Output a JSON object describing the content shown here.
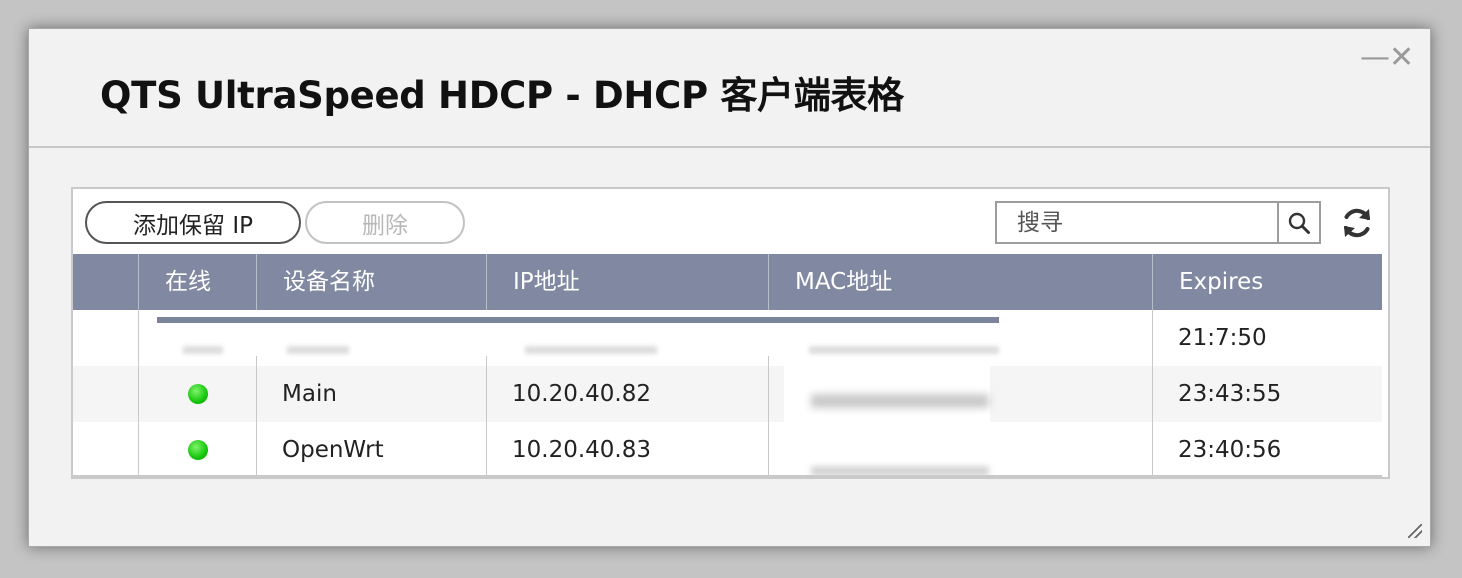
{
  "window": {
    "title": "QTS UltraSpeed HDCP - DHCP 客户端表格",
    "minimize_glyph": "—",
    "close_glyph": "✕"
  },
  "toolbar": {
    "add_reserved_ip_label": "添加保留 IP",
    "delete_label": "删除",
    "search_placeholder": "搜寻",
    "search_icon": "search-icon",
    "refresh_icon": "refresh-icon"
  },
  "table": {
    "columns": [
      "",
      "在线",
      "设备名称",
      "IP地址",
      "MAC地址",
      "Expires"
    ],
    "rows": [
      {
        "online": null,
        "device_name": "",
        "ip": "",
        "mac": "",
        "expires": "21:7:50",
        "redacted": true
      },
      {
        "online": true,
        "device_name": "Main",
        "ip": "10.20.40.82",
        "mac": "",
        "expires": "23:43:55",
        "redacted": false
      },
      {
        "online": true,
        "device_name": "OpenWrt",
        "ip": "10.20.40.83",
        "mac": "",
        "expires": "23:40:56",
        "redacted": false
      }
    ]
  },
  "colors": {
    "header_bg": "#8089a1",
    "online_dot": "#16c60c"
  }
}
